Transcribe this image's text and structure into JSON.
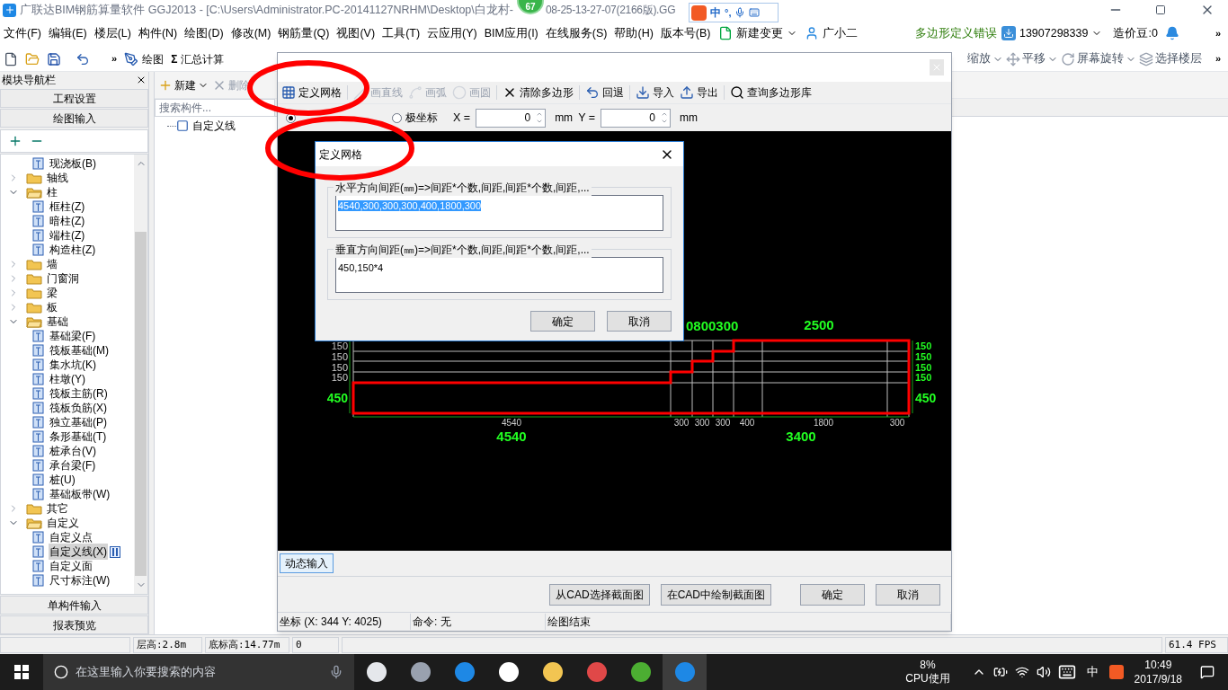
{
  "window": {
    "title": "广联达BIM钢筋算量软件 GGJ2013 - [C:\\Users\\Administrator.PC-20141127NRHM\\Desktop\\白龙村-",
    "title_tail": "08-25-13-27-07(2166版).GG"
  },
  "badge": {
    "count": "67"
  },
  "ime": {
    "mode": "中",
    "punct": "°,"
  },
  "menu": [
    "文件(F)",
    "编辑(E)",
    "楼层(L)",
    "构件(N)",
    "绘图(D)",
    "修改(M)",
    "钢筋量(Q)",
    "视图(V)",
    "工具(T)",
    "云应用(Y)",
    "BIM应用(I)",
    "在线服务(S)",
    "帮助(H)",
    "版本号(B)"
  ],
  "menu_extras": {
    "new_change": "新建变更",
    "assistant": "广小二",
    "message": "多边形定义错误",
    "phone": "13907298339",
    "beans": "造价豆:0"
  },
  "toolbar": {
    "items": [
      "绘图",
      "汇总计算"
    ],
    "sigma": "Σ",
    "more": "»",
    "right_items": [
      "缩放",
      "平移",
      "屏幕旋转",
      "选择楼层"
    ]
  },
  "nav": {
    "title": "模块导航栏",
    "sections": [
      "工程设置",
      "绘图输入"
    ],
    "bottom_sections": [
      "单构件输入",
      "报表预览"
    ],
    "tree": [
      {
        "children": [
          {
            "label": "现浇板(B)",
            "selected": false
          }
        ]
      },
      {
        "label": "轴线",
        "expanded": false
      },
      {
        "label": "柱",
        "expanded": true,
        "children": [
          {
            "label": "框柱(Z)",
            "selected": false
          },
          {
            "label": "暗柱(Z)",
            "selected": false
          },
          {
            "label": "端柱(Z)",
            "selected": false
          },
          {
            "label": "构造柱(Z)",
            "selected": false
          }
        ]
      },
      {
        "label": "墙",
        "expanded": false
      },
      {
        "label": "门窗洞",
        "expanded": false
      },
      {
        "label": "梁",
        "expanded": false
      },
      {
        "label": "板",
        "expanded": false
      },
      {
        "label": "基础",
        "expanded": true,
        "children": [
          {
            "label": "基础梁(F)",
            "selected": false
          },
          {
            "label": "筏板基础(M)",
            "selected": false
          },
          {
            "label": "集水坑(K)",
            "selected": false
          },
          {
            "label": "柱墩(Y)",
            "selected": false
          },
          {
            "label": "筏板主筋(R)",
            "selected": false
          },
          {
            "label": "筏板负筋(X)",
            "selected": false
          },
          {
            "label": "独立基础(P)",
            "selected": false
          },
          {
            "label": "条形基础(T)",
            "selected": false
          },
          {
            "label": "桩承台(V)",
            "selected": false
          },
          {
            "label": "承台梁(F)",
            "selected": false
          },
          {
            "label": "桩(U)",
            "selected": false
          },
          {
            "label": "基础板带(W)",
            "selected": false
          }
        ]
      },
      {
        "label": "其它",
        "expanded": false
      },
      {
        "label": "自定义",
        "expanded": true,
        "children": [
          {
            "label": "自定义点",
            "selected": false
          },
          {
            "label": "自定义线(X)",
            "selected": true
          },
          {
            "label": "自定义面",
            "selected": false
          },
          {
            "label": "尺寸标注(W)",
            "selected": false
          }
        ]
      }
    ]
  },
  "components": {
    "toolbar": [
      "新建",
      "删除"
    ],
    "search": {
      "placeholder": "搜索构件..."
    },
    "items": [
      "自定义线"
    ]
  },
  "editor": {
    "tools": [
      {
        "kind": "grid",
        "label": "定义网格",
        "disabled": false
      },
      {
        "kind": "line",
        "label": "画直线",
        "disabled": true
      },
      {
        "kind": "arc",
        "label": "画弧",
        "disabled": true
      },
      {
        "kind": "circle",
        "label": "画圆",
        "disabled": true
      },
      {
        "kind": "clear",
        "label": "清除多边形",
        "disabled": false
      },
      {
        "kind": "undo",
        "label": "回退",
        "disabled": false
      },
      {
        "kind": "import",
        "label": "导入",
        "disabled": false
      },
      {
        "kind": "export",
        "label": "导出",
        "disabled": false
      },
      {
        "kind": "search",
        "label": "查询多边形库",
        "disabled": false
      }
    ],
    "modes": [
      {
        "selected": true
      },
      {
        "label": "极坐标",
        "selected": false
      }
    ],
    "x": {
      "label": "X =",
      "value": "0",
      "unit": "mm"
    },
    "y": {
      "label": "Y =",
      "value": "0",
      "unit": "mm"
    },
    "cad": {
      "top_labels": [
        "0800300",
        "2500"
      ],
      "left_labels": [
        "150",
        "150",
        "150",
        "150",
        "450"
      ],
      "right_labels": [
        "150",
        "150",
        "150",
        "150",
        "450"
      ],
      "bottom_small": [
        "4540",
        "300",
        "300",
        "300",
        "400",
        "1800",
        "300"
      ],
      "bottom_big": [
        "4540",
        "3400"
      ]
    },
    "dynamic_input": "动态输入",
    "buttons": [
      "从CAD选择截面图",
      "在CAD中绘制截面图",
      "确定",
      "取消"
    ],
    "status": [
      "坐标 (X: 344 Y: 4025)",
      "命令: 无",
      "绘图结束"
    ]
  },
  "grid_dialog": {
    "title": "定义网格",
    "groups": [
      {
        "label": "水平方向间距(㎜)=>间距*个数,间距,间距*个数,间距,...",
        "value": "4540,300,300,300,400,1800,300",
        "selected": true
      },
      {
        "label": "垂直方向间距(㎜)=>间距*个数,间距,间距*个数,间距,...",
        "value": "450,150*4",
        "selected": false
      }
    ],
    "buttons": [
      "确定",
      "取消"
    ]
  },
  "status_bar": [
    "层高:2.8m",
    "底标高:14.77m",
    "0",
    "61.4 FPS"
  ],
  "taskbar": {
    "search_placeholder": "在这里输入你要搜索的内容",
    "cpu_value": "8%",
    "cpu_label": "CPU使用",
    "ime": "中",
    "time": "10:49",
    "date": "2017/9/18"
  }
}
